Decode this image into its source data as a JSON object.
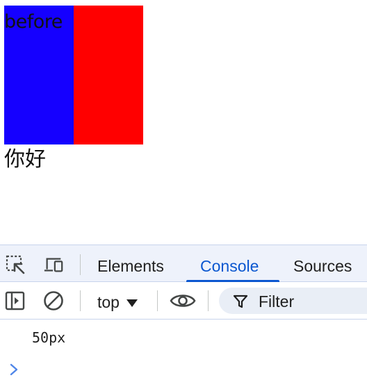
{
  "content": {
    "before_text": "before",
    "greeting": "你好",
    "colors": {
      "blue_box": "#1500ff",
      "red_box": "#ff0000"
    }
  },
  "devtools": {
    "tabs": [
      {
        "label": "Elements",
        "active": false
      },
      {
        "label": "Console",
        "active": true
      },
      {
        "label": "Sources",
        "active": false
      }
    ],
    "toolbar": {
      "context": "top",
      "filter_placeholder": "Filter"
    },
    "console_output": [
      "50px"
    ],
    "icons": {
      "inspect": "inspect-element-icon",
      "device": "device-toolbar-icon",
      "sidebar": "show-sidebar-icon",
      "clear": "clear-console-icon",
      "eye": "live-expression-icon",
      "filter": "filter-icon",
      "prompt": "chevron-right-icon"
    },
    "accent_color": "#0b57d0"
  }
}
